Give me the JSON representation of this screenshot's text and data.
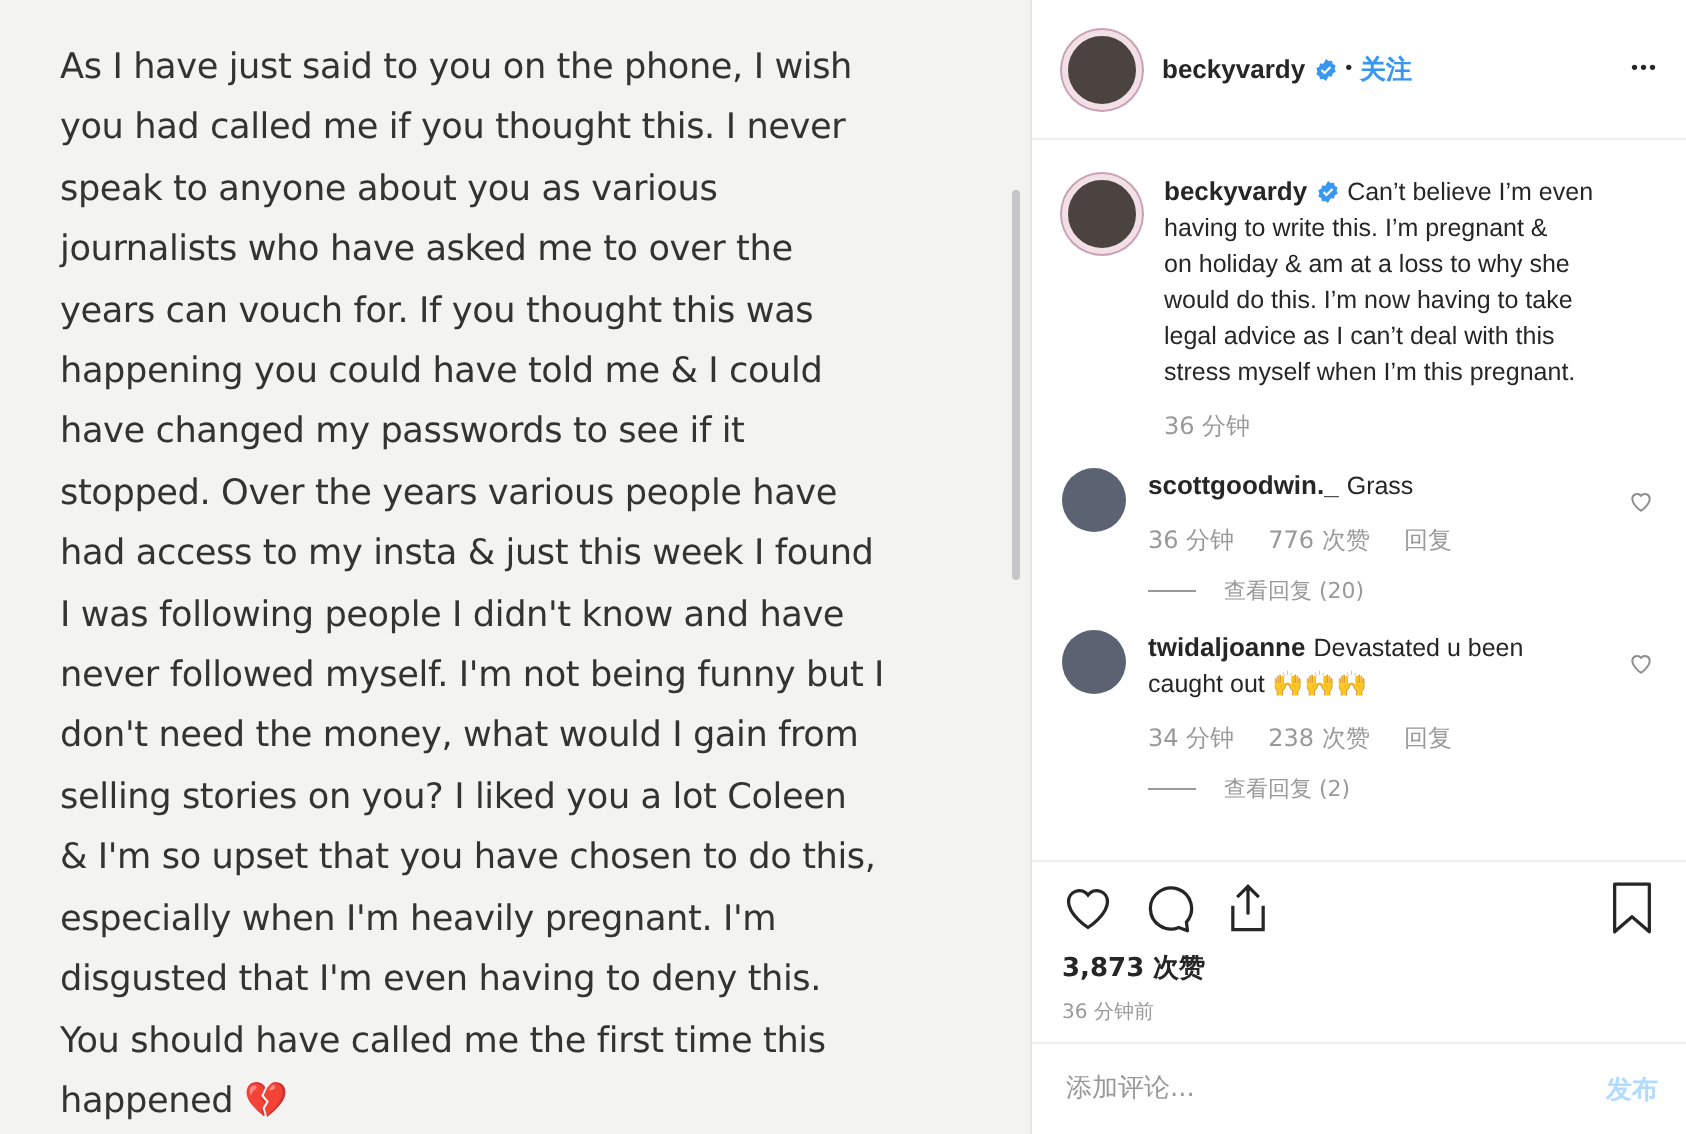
{
  "note": {
    "lines": [
      "As I have just said to you on the phone, I wish",
      "you had called me if you thought this. I never",
      "speak to anyone about you as various",
      "journalists who have asked me to over the",
      "years can vouch for. If you thought this was",
      "happening you could have told me & I could",
      "have changed my passwords to see if it",
      "stopped. Over the years various people have",
      "had access to my insta & just this week I found",
      "I was following people I didn't know and have",
      "never followed myself. I'm not being funny but I",
      "don't need the money, what would I gain from",
      "selling stories on you? I liked you a lot Coleen",
      "& I'm so upset that you have chosen to do this,",
      "especially when I'm heavily pregnant. I'm",
      "disgusted that I'm even having to deny this.",
      "You should have called me the first time this",
      "happened 💔"
    ]
  },
  "post": {
    "author": {
      "username": "beckyvardy",
      "verified": true,
      "separator": "•",
      "follow": "关注",
      "more": "•••"
    },
    "caption": {
      "username": "beckyvardy",
      "verified": true,
      "lines": [
        "Can’t believe I’m even",
        "having to write this. I’m pregnant &",
        "on holiday & am at a loss to why she",
        "would do this. I’m now having to take",
        "legal advice as I can’t deal with this",
        "stress myself when I’m this pregnant."
      ],
      "time": "36 分钟"
    },
    "comments": [
      {
        "username": "scottgoodwin._",
        "lines": [
          "Grass"
        ],
        "time": "36 分钟",
        "likes": "776 次赞",
        "reply": "回复",
        "view_replies": "查看回复 (20)",
        "liked": false
      },
      {
        "username": "twidaljoanne",
        "lines": [
          "Devastated u been",
          "caught out 🙌🙌🙌"
        ],
        "time": "34 分钟",
        "likes": "238 次赞",
        "reply": "回复",
        "view_replies": "查看回复 (2)",
        "liked": false
      }
    ],
    "likes": "3,873 次赞",
    "posted": "36 分钟前",
    "comment_field": {
      "placeholder": "添加评论..."
    },
    "publish_button": "发布"
  }
}
